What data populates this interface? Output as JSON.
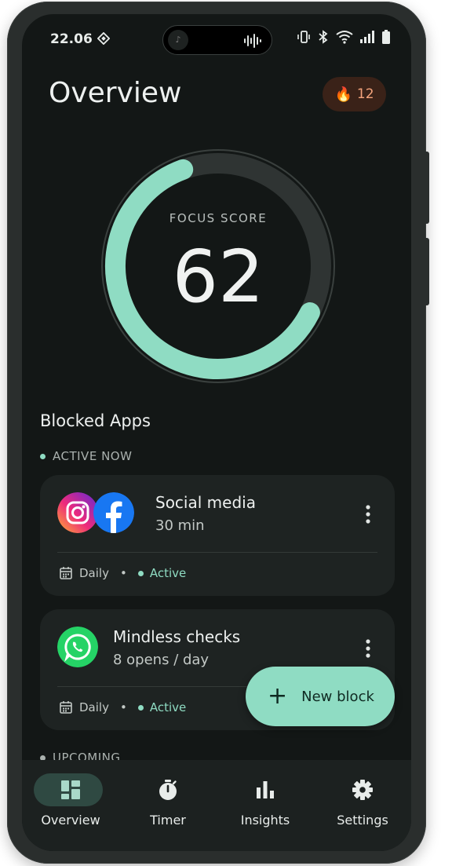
{
  "status_bar": {
    "time": "22.06"
  },
  "header": {
    "title": "Overview",
    "streak": "12"
  },
  "focus": {
    "label": "FOCUS SCORE",
    "score": "62",
    "progress": 0.62
  },
  "blocked": {
    "title": "Blocked Apps",
    "active_label": "ACTIVE NOW",
    "upcoming_label": "UPCOMING",
    "cards": [
      {
        "name": "Social media",
        "limit": "30 min",
        "schedule": "Daily",
        "status": "Active"
      },
      {
        "name": "Mindless checks",
        "limit": "8 opens / day",
        "schedule": "Daily",
        "status": "Active"
      }
    ]
  },
  "fab": {
    "label": "New block"
  },
  "nav": [
    {
      "label": "Overview",
      "icon": "dashboard-icon",
      "active": true
    },
    {
      "label": "Timer",
      "icon": "stopwatch-icon",
      "active": false
    },
    {
      "label": "Insights",
      "icon": "bar-chart-icon",
      "active": false
    },
    {
      "label": "Settings",
      "icon": "gear-icon",
      "active": false
    }
  ],
  "colors": {
    "accent": "#8fdcc3",
    "background": "#131716",
    "card": "#1e2322",
    "streak_text": "#f4a37c"
  }
}
